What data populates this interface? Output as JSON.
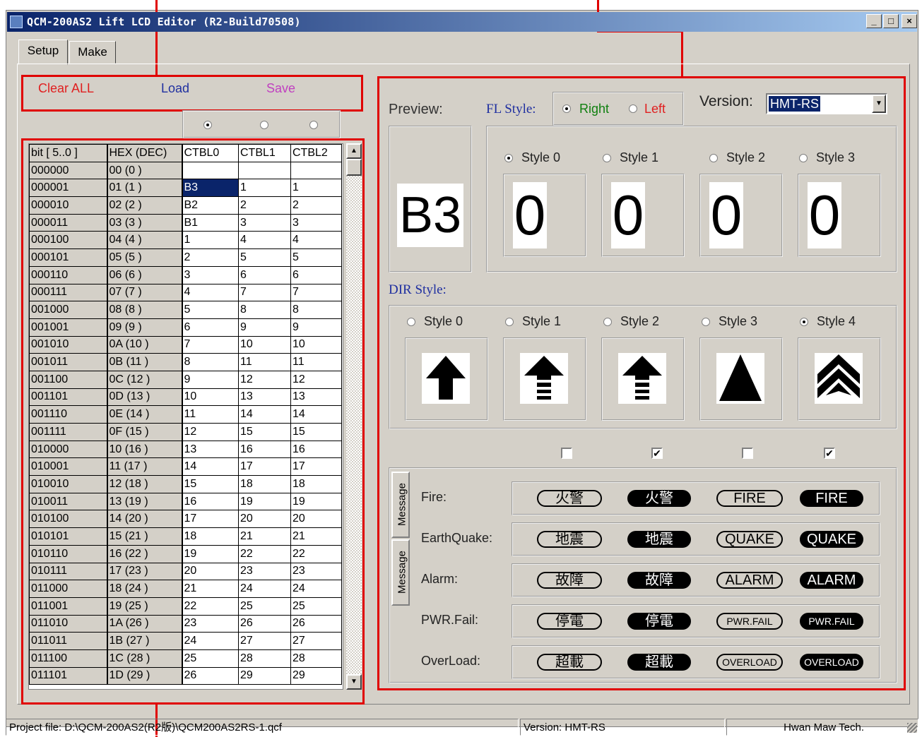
{
  "window": {
    "title": "QCM-200AS2 Lift LCD Editor (R2-Build70508)",
    "min_label": "_",
    "max_label": "□",
    "close_label": "×"
  },
  "tabs": [
    {
      "label": "Setup",
      "active": true
    },
    {
      "label": "Make",
      "active": false
    }
  ],
  "toolbar": {
    "clear_label": "Clear ALL",
    "load_label": "Load",
    "save_label": "Save",
    "clear_color": "#e02020",
    "load_color": "#2030a0",
    "save_color": "#c040c0"
  },
  "table_selector": {
    "selected_index": 0
  },
  "grid": {
    "headers": [
      "bit [ 5..0 ]",
      "HEX (DEC)",
      "CTBL0",
      "CTBL1",
      "CTBL2"
    ],
    "rows": [
      [
        "000000",
        "00 (0 )",
        "",
        "",
        ""
      ],
      [
        "000001",
        "01 (1 )",
        "B3",
        "1",
        "1"
      ],
      [
        "000010",
        "02 (2 )",
        "B2",
        "2",
        "2"
      ],
      [
        "000011",
        "03 (3 )",
        "B1",
        "3",
        "3"
      ],
      [
        "000100",
        "04 (4 )",
        "1",
        "4",
        "4"
      ],
      [
        "000101",
        "05 (5 )",
        "2",
        "5",
        "5"
      ],
      [
        "000110",
        "06 (6 )",
        "3",
        "6",
        "6"
      ],
      [
        "000111",
        "07 (7 )",
        "4",
        "7",
        "7"
      ],
      [
        "001000",
        "08 (8 )",
        "5",
        "8",
        "8"
      ],
      [
        "001001",
        "09 (9 )",
        "6",
        "9",
        "9"
      ],
      [
        "001010",
        "0A (10 )",
        "7",
        "10",
        "10"
      ],
      [
        "001011",
        "0B (11 )",
        "8",
        "11",
        "11"
      ],
      [
        "001100",
        "0C (12 )",
        "9",
        "12",
        "12"
      ],
      [
        "001101",
        "0D (13 )",
        "10",
        "13",
        "13"
      ],
      [
        "001110",
        "0E (14 )",
        "11",
        "14",
        "14"
      ],
      [
        "001111",
        "0F (15 )",
        "12",
        "15",
        "15"
      ],
      [
        "010000",
        "10 (16 )",
        "13",
        "16",
        "16"
      ],
      [
        "010001",
        "11 (17 )",
        "14",
        "17",
        "17"
      ],
      [
        "010010",
        "12 (18 )",
        "15",
        "18",
        "18"
      ],
      [
        "010011",
        "13 (19 )",
        "16",
        "19",
        "19"
      ],
      [
        "010100",
        "14 (20 )",
        "17",
        "20",
        "20"
      ],
      [
        "010101",
        "15 (21 )",
        "18",
        "21",
        "21"
      ],
      [
        "010110",
        "16 (22 )",
        "19",
        "22",
        "22"
      ],
      [
        "010111",
        "17 (23 )",
        "20",
        "23",
        "23"
      ],
      [
        "011000",
        "18 (24 )",
        "21",
        "24",
        "24"
      ],
      [
        "011001",
        "19 (25 )",
        "22",
        "25",
        "25"
      ],
      [
        "011010",
        "1A (26 )",
        "23",
        "26",
        "26"
      ],
      [
        "011011",
        "1B (27 )",
        "24",
        "27",
        "27"
      ],
      [
        "011100",
        "1C (28 )",
        "25",
        "28",
        "28"
      ],
      [
        "011101",
        "1D (29 )",
        "26",
        "29",
        "29"
      ]
    ],
    "selected_row": 1,
    "selected_col": 2
  },
  "preview": {
    "label": "Preview:",
    "value": "B3",
    "fl_style_label": "FL Style:",
    "fl_right": "Right",
    "fl_left": "Left",
    "fl_selected": "Right",
    "version_label": "Version:",
    "version_value": "HMT-RS",
    "styles": [
      {
        "label": "Style 0",
        "digit": "0",
        "selected": true
      },
      {
        "label": "Style 1",
        "digit": "0",
        "selected": false
      },
      {
        "label": "Style 2",
        "digit": "0",
        "selected": false
      },
      {
        "label": "Style 3",
        "digit": "0",
        "selected": false
      }
    ]
  },
  "dir_style": {
    "label": "DIR Style:",
    "styles": [
      {
        "label": "Style 0",
        "icon": "up-arrow-icon",
        "selected": false
      },
      {
        "label": "Style 1",
        "icon": "up-arrow-striped-icon",
        "selected": false
      },
      {
        "label": "Style 2",
        "icon": "up-arrow-striped-icon",
        "selected": false
      },
      {
        "label": "Style 3",
        "icon": "triangle-up-icon",
        "selected": false
      },
      {
        "label": "Style 4",
        "icon": "double-chevron-up-icon",
        "selected": true
      }
    ]
  },
  "message": {
    "side_tab_1": "Message",
    "side_tab_2": "Message",
    "checkboxes": [
      false,
      true,
      false,
      true
    ],
    "rows": [
      {
        "label": "Fire:",
        "options": [
          "火警",
          "火警",
          "FIRE",
          "FIRE"
        ]
      },
      {
        "label": "EarthQuake:",
        "options": [
          "地震",
          "地震",
          "QUAKE",
          "QUAKE"
        ]
      },
      {
        "label": "Alarm:",
        "options": [
          "故障",
          "故障",
          "ALARM",
          "ALARM"
        ]
      },
      {
        "label": "PWR.Fail:",
        "options": [
          "停電",
          "停電",
          "PWR.FAIL",
          "PWR.FAIL"
        ]
      },
      {
        "label": "OverLoad:",
        "options": [
          "超載",
          "超載",
          "OVERLOAD",
          "OVERLOAD"
        ]
      }
    ]
  },
  "status_bar": {
    "project_file": "Project file: D:\\QCM-200AS2(R2版)\\QCM200AS2RS-1.qcf",
    "version": "Version: HMT-RS",
    "company": "Hwan Maw Tech."
  }
}
